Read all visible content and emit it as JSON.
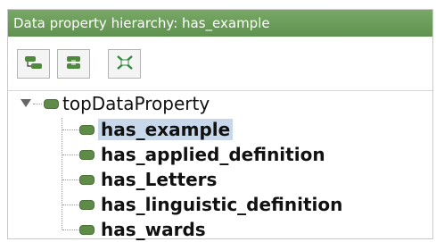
{
  "header": {
    "title": "Data property hierarchy: has_example"
  },
  "toolbar": {
    "buttons": [
      {
        "icon": "add-subproperty-icon"
      },
      {
        "icon": "add-sibling-property-icon"
      },
      {
        "icon": "delete-property-icon"
      }
    ]
  },
  "tree": {
    "root": {
      "label": "topDataProperty",
      "expanded": true
    },
    "children": [
      {
        "label": "has_example",
        "selected": true
      },
      {
        "label": "has_applied_definition",
        "selected": false
      },
      {
        "label": "has_Letters",
        "selected": false
      },
      {
        "label": "has_linguistic_definition",
        "selected": false
      },
      {
        "label": "has_wards",
        "selected": false
      }
    ]
  },
  "colors": {
    "header_bg": "#6a9c58",
    "property_icon": "#5e8b47",
    "selection": "#c8d8ea"
  }
}
